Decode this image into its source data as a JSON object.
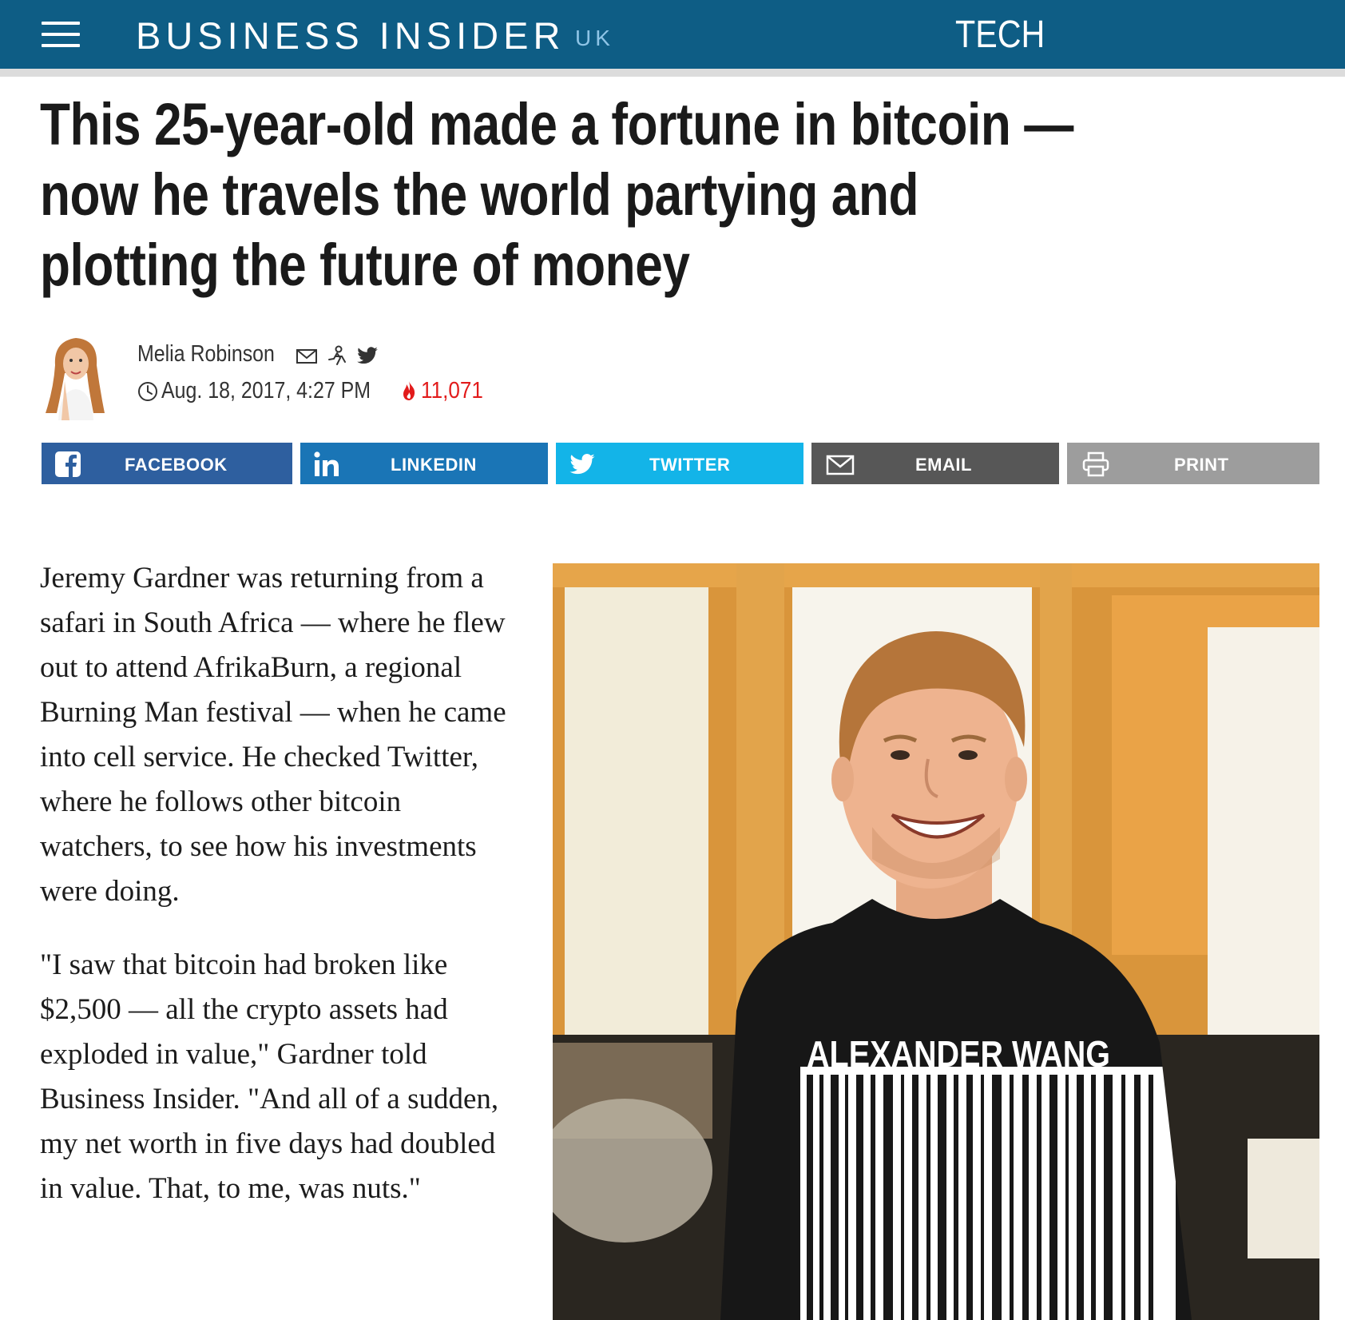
{
  "header": {
    "menu_icon": "hamburger-menu-icon",
    "brand_name": "BUSINESS INSIDER",
    "brand_edition": "UK",
    "section": "TECH",
    "bar_color": "#0e5d85"
  },
  "article": {
    "headline": "This 25-year-old made a fortune in bitcoin — now he travels the world partying and plotting the future of money",
    "author": {
      "name": "Melia Robinson",
      "photo": "author-portrait",
      "contact_icons": [
        "email-icon",
        "follow-author-icon",
        "twitter-icon"
      ]
    },
    "date": "Aug. 18, 2017, 4:27 PM",
    "views": "11,071",
    "views_color": "#e21b1b",
    "paragraphs": [
      "Jeremy Gardner was returning from a safari in South Africa — where he flew out to attend AfrikaBurn, a regional Burning Man festival — when he came into cell service. He checked Twitter, where he follows other bitcoin watchers, to see how his investments were doing.",
      "\"I saw that bitcoin had broken like $2,500 — all the crypto assets had exploded in value,\" Gardner told Business Insider. \"And all of a sudden, my net worth in five days had doubled in value. That, to me, was nuts.\""
    ],
    "hero_image": {
      "shirt_text": "ALEXANDER WANG"
    }
  },
  "share": {
    "facebook": {
      "label": "FACEBOOK",
      "color": "#2e5f9f",
      "icon": "facebook-icon"
    },
    "linkedin": {
      "label": "LINKEDIN",
      "color": "#1a75b6",
      "icon": "linkedin-icon"
    },
    "twitter": {
      "label": "TWITTER",
      "color": "#13b4e8",
      "icon": "twitter-icon"
    },
    "email": {
      "label": "EMAIL",
      "color": "#575757",
      "icon": "email-icon"
    },
    "print": {
      "label": "PRINT",
      "color": "#9d9d9d",
      "icon": "printer-icon"
    }
  }
}
